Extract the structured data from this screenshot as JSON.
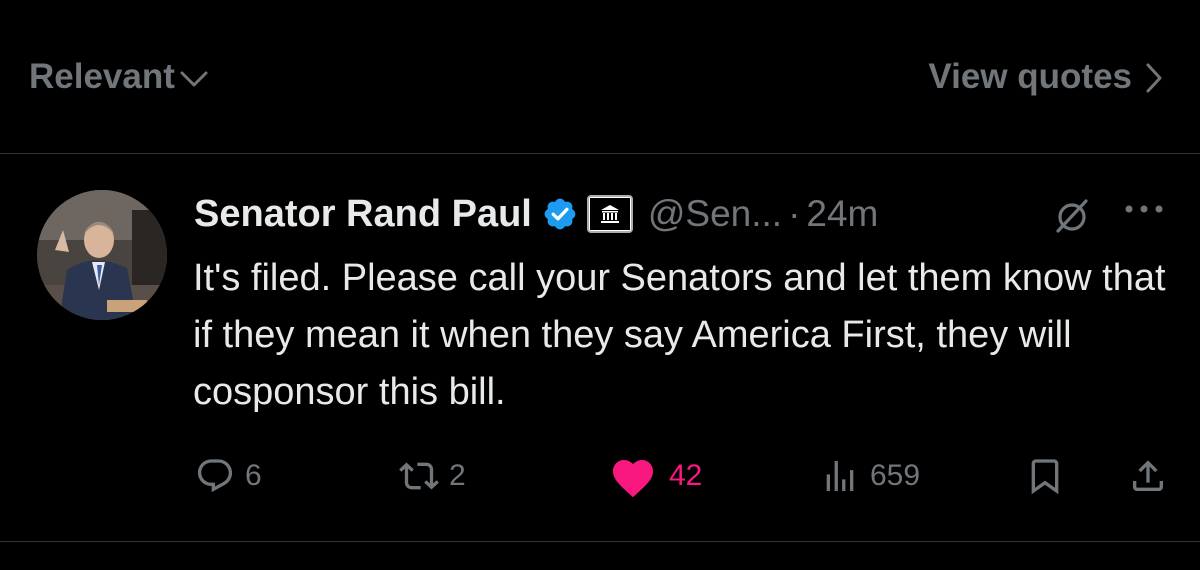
{
  "topbar": {
    "sort_label": "Relevant",
    "sort_icon": "chevron-down-icon",
    "quotes_label": "View quotes",
    "quotes_icon": "chevron-right-icon"
  },
  "tweet": {
    "author_name": "Senator Rand Paul",
    "verified_badge": "verified-badge-icon",
    "affiliation_badge": "government-building-icon",
    "handle": "@Sen...",
    "separator": "·",
    "time": "24m",
    "text": "It's filed. Please call your Senators and let them know that if they mean it when they say America First, they will cosponsor this bill.",
    "actions": {
      "replies": "6",
      "reposts": "2",
      "likes": "42",
      "views": "659"
    },
    "liked": true
  },
  "colors": {
    "background": "#000000",
    "text_primary": "#e7e9ea",
    "text_secondary": "#71767b",
    "verified_blue": "#1d9bf0",
    "like_pink": "#f91880",
    "divider": "#2f3336"
  }
}
